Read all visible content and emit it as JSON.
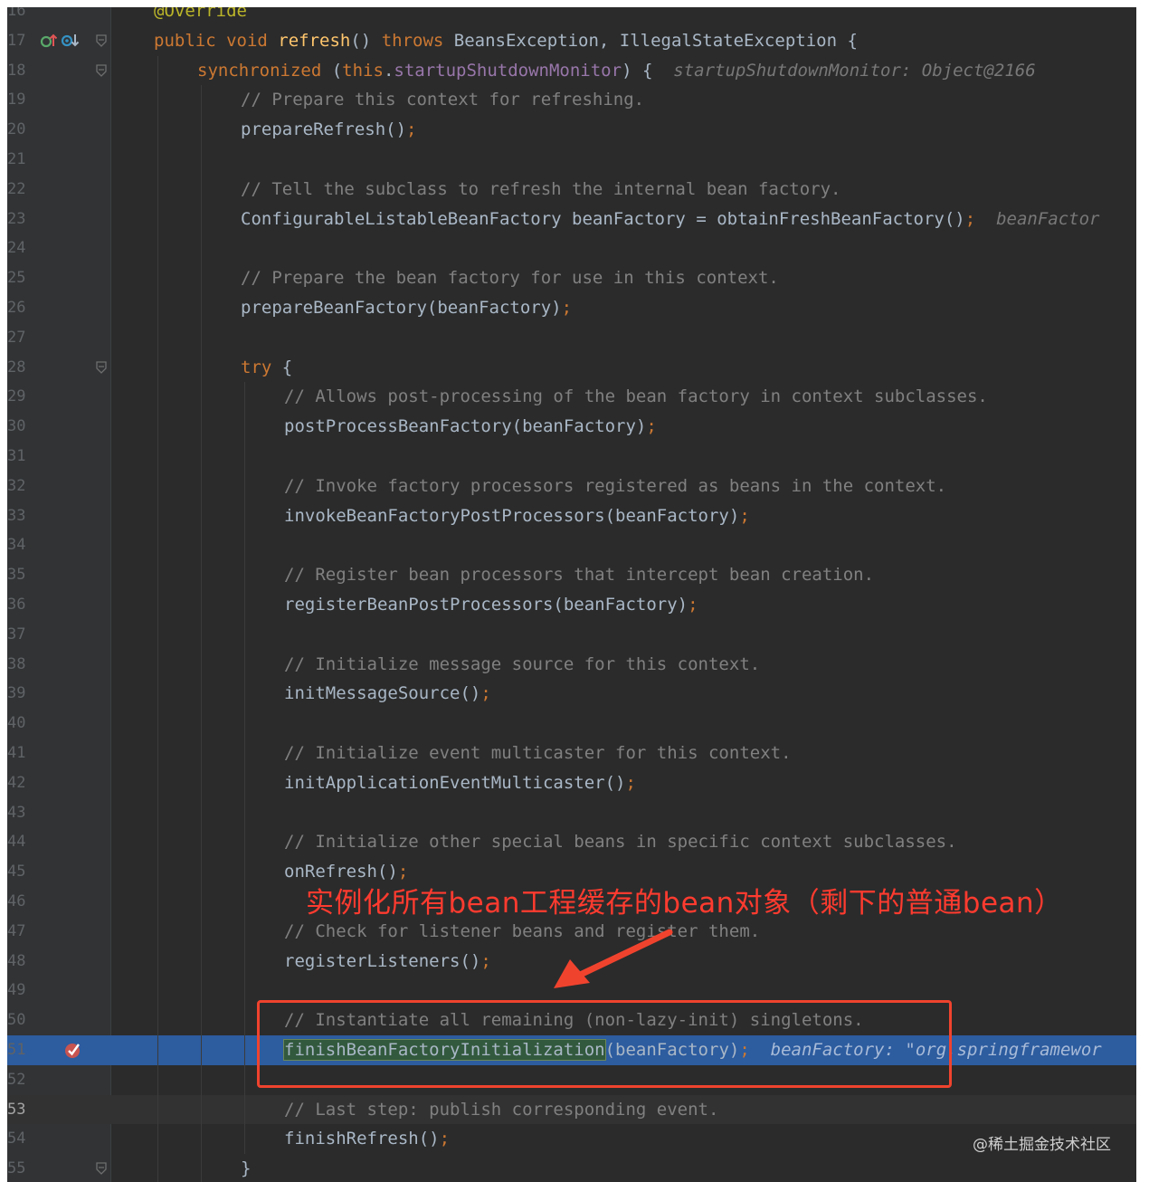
{
  "colors": {
    "editor_bg": "#2b2b2b",
    "gutter_bg": "#313335",
    "keyword": "#cc7832",
    "method": "#ffc66d",
    "plain": "#a9b7c6",
    "field": "#9876aa",
    "comment": "#808080",
    "annotation": "#bbb529",
    "exec_line": "#2d5c9f",
    "callout_red": "#f0432e"
  },
  "lines": [
    {
      "n": "16",
      "indent": 0,
      "tokens": [
        [
          "anno",
          "@Override"
        ]
      ]
    },
    {
      "n": "17",
      "indent": 0,
      "gutter": "override-implement",
      "fold": true,
      "tokens": [
        [
          "kw",
          "public void "
        ],
        [
          "fn",
          "refresh"
        ],
        [
          "plain",
          "() "
        ],
        [
          "kw",
          "throws "
        ],
        [
          "plain",
          "BeansException, IllegalStateException {"
        ]
      ]
    },
    {
      "n": "18",
      "indent": 1,
      "fold": true,
      "tokens": [
        [
          "kw",
          "synchronized "
        ],
        [
          "plain",
          "("
        ],
        [
          "kw",
          "this"
        ],
        [
          "plain",
          "."
        ],
        [
          "field",
          "startupShutdownMonitor"
        ],
        [
          "plain",
          ") {  "
        ],
        [
          "hint",
          "startupShutdownMonitor: Object@2166"
        ]
      ]
    },
    {
      "n": "19",
      "indent": 2,
      "tokens": [
        [
          "comment",
          "// Prepare this context for refreshing."
        ]
      ]
    },
    {
      "n": "20",
      "indent": 2,
      "tokens": [
        [
          "plain",
          "prepareRefresh()"
        ],
        [
          "kw",
          ";"
        ]
      ]
    },
    {
      "n": "21",
      "indent": 2,
      "tokens": []
    },
    {
      "n": "22",
      "indent": 2,
      "tokens": [
        [
          "comment",
          "// Tell the subclass to refresh the internal bean factory."
        ]
      ]
    },
    {
      "n": "23",
      "indent": 2,
      "tokens": [
        [
          "plain",
          "ConfigurableListableBeanFactory beanFactory = obtainFreshBeanFactory()"
        ],
        [
          "kw",
          ";"
        ],
        [
          "plain",
          "  "
        ],
        [
          "hint",
          "beanFactor"
        ]
      ]
    },
    {
      "n": "24",
      "indent": 2,
      "tokens": []
    },
    {
      "n": "25",
      "indent": 2,
      "tokens": [
        [
          "comment",
          "// Prepare the bean factory for use in this context."
        ]
      ]
    },
    {
      "n": "26",
      "indent": 2,
      "tokens": [
        [
          "plain",
          "prepareBeanFactory(beanFactory)"
        ],
        [
          "kw",
          ";"
        ]
      ]
    },
    {
      "n": "27",
      "indent": 2,
      "tokens": []
    },
    {
      "n": "28",
      "indent": 2,
      "fold": true,
      "tokens": [
        [
          "kw",
          "try "
        ],
        [
          "plain",
          "{"
        ]
      ]
    },
    {
      "n": "29",
      "indent": 3,
      "tokens": [
        [
          "comment",
          "// Allows post-processing of the bean factory in context subclasses."
        ]
      ]
    },
    {
      "n": "30",
      "indent": 3,
      "tokens": [
        [
          "plain",
          "postProcessBeanFactory(beanFactory)"
        ],
        [
          "kw",
          ";"
        ]
      ]
    },
    {
      "n": "31",
      "indent": 3,
      "tokens": []
    },
    {
      "n": "32",
      "indent": 3,
      "tokens": [
        [
          "comment",
          "// Invoke factory processors registered as beans in the context."
        ]
      ]
    },
    {
      "n": "33",
      "indent": 3,
      "tokens": [
        [
          "plain",
          "invokeBeanFactoryPostProcessors(beanFactory)"
        ],
        [
          "kw",
          ";"
        ]
      ]
    },
    {
      "n": "34",
      "indent": 3,
      "tokens": []
    },
    {
      "n": "35",
      "indent": 3,
      "tokens": [
        [
          "comment",
          "// Register bean processors that intercept bean creation."
        ]
      ]
    },
    {
      "n": "36",
      "indent": 3,
      "tokens": [
        [
          "plain",
          "registerBeanPostProcessors(beanFactory)"
        ],
        [
          "kw",
          ";"
        ]
      ]
    },
    {
      "n": "37",
      "indent": 3,
      "tokens": []
    },
    {
      "n": "38",
      "indent": 3,
      "tokens": [
        [
          "comment",
          "// Initialize message source for this context."
        ]
      ]
    },
    {
      "n": "39",
      "indent": 3,
      "tokens": [
        [
          "plain",
          "initMessageSource()"
        ],
        [
          "kw",
          ";"
        ]
      ]
    },
    {
      "n": "40",
      "indent": 3,
      "tokens": []
    },
    {
      "n": "41",
      "indent": 3,
      "tokens": [
        [
          "comment",
          "// Initialize event multicaster for this context."
        ]
      ]
    },
    {
      "n": "42",
      "indent": 3,
      "tokens": [
        [
          "plain",
          "initApplicationEventMulticaster()"
        ],
        [
          "kw",
          ";"
        ]
      ]
    },
    {
      "n": "43",
      "indent": 3,
      "tokens": []
    },
    {
      "n": "44",
      "indent": 3,
      "tokens": [
        [
          "comment",
          "// Initialize other special beans in specific context subclasses."
        ]
      ]
    },
    {
      "n": "45",
      "indent": 3,
      "tokens": [
        [
          "plain",
          "onRefresh()"
        ],
        [
          "kw",
          ";"
        ]
      ]
    },
    {
      "n": "46",
      "indent": 3,
      "tokens": []
    },
    {
      "n": "47",
      "indent": 3,
      "tokens": [
        [
          "comment",
          "// Check for listener beans and register them."
        ]
      ]
    },
    {
      "n": "48",
      "indent": 3,
      "tokens": [
        [
          "plain",
          "registerListeners()"
        ],
        [
          "kw",
          ";"
        ]
      ]
    },
    {
      "n": "49",
      "indent": 3,
      "tokens": []
    },
    {
      "n": "50",
      "indent": 3,
      "tokens": [
        [
          "comment",
          "// Instantiate all remaining (non-lazy-init) singletons."
        ]
      ]
    },
    {
      "n": "51",
      "indent": 3,
      "exec": true,
      "gutter": "breakpoint",
      "tokens": [
        [
          "sel",
          "finishBeanFactoryInitialization"
        ],
        [
          "plain",
          "(beanFactory)"
        ],
        [
          "kw",
          ";"
        ],
        [
          "plain",
          "  "
        ],
        [
          "hint",
          "beanFactory: \"org.springframewor"
        ]
      ]
    },
    {
      "n": "52",
      "indent": 3,
      "tokens": []
    },
    {
      "n": "53",
      "indent": 3,
      "current": true,
      "tokens": [
        [
          "comment",
          "// Last step: publish corresponding event."
        ]
      ]
    },
    {
      "n": "54",
      "indent": 3,
      "tokens": [
        [
          "plain",
          "finishRefresh()"
        ],
        [
          "kw",
          ";"
        ]
      ]
    },
    {
      "n": "55",
      "indent": 2,
      "fold": true,
      "tokens": [
        [
          "plain",
          "}"
        ]
      ]
    }
  ],
  "callout": {
    "text": "实例化所有bean工程缓存的bean对象（剩下的普通bean）"
  },
  "watermark": "@稀土掘金技术社区"
}
